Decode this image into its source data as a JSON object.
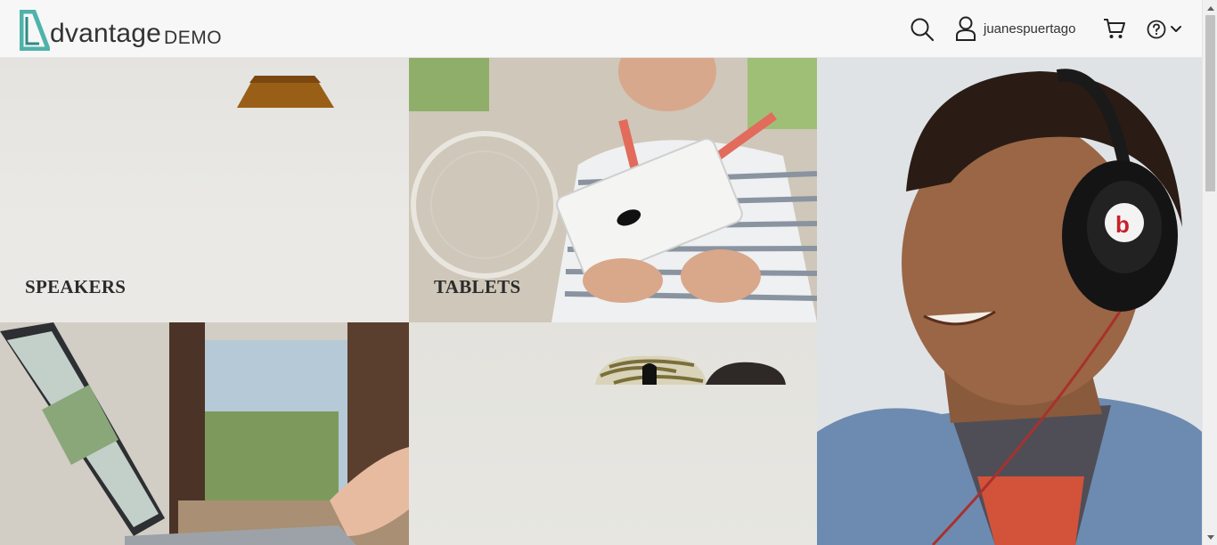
{
  "header": {
    "logo_text": "dvantage",
    "logo_demo": "DEMO",
    "username": "juanespuertago",
    "icons": {
      "search": "search-icon",
      "user": "user-icon",
      "cart": "cart-icon",
      "help": "help-icon",
      "chevron": "chevron-down-icon"
    },
    "accent_color": "#4fb3a9"
  },
  "tiles": {
    "speakers": {
      "label": "SPEAKERS"
    },
    "tablets": {
      "label": "TABLETS"
    },
    "headphones": {
      "label": ""
    },
    "laptops": {
      "label": ""
    },
    "mice": {
      "label": ""
    }
  }
}
